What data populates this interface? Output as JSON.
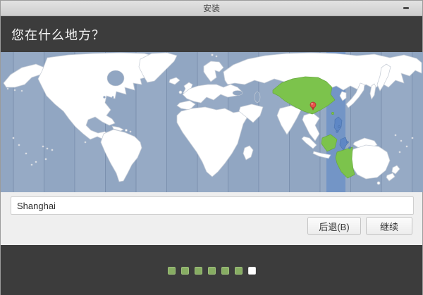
{
  "titlebar": {
    "title": "安装",
    "control_icon": "dash-icon"
  },
  "header": {
    "question": "您在什么地方？"
  },
  "location": {
    "value": "Shanghai"
  },
  "actions": {
    "back": "后退(B)",
    "continue": "继续"
  },
  "progress": {
    "total_steps": 7,
    "completed_steps": 6
  },
  "map": {
    "marker_icon": "map-pin-icon",
    "highlight_style": "selected timezone band and regions"
  },
  "colors": {
    "titlebar_bg": "#d6d6d6",
    "dark_bg": "#3c3c3c",
    "panel_bg": "#efefef",
    "ocean": "#91a6c2",
    "timezone_band": "#5d87c6",
    "land": "#ffffff",
    "land_border": "#c9cfd8",
    "region_highlight": "#7cc34c",
    "island_highlight": "#5e87c5",
    "dot_done": "#87ad63",
    "dot_current": "#ffffff",
    "marker_red": "#e8534a"
  }
}
